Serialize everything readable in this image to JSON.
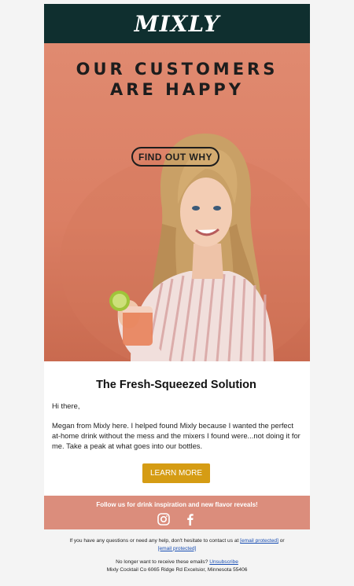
{
  "header": {
    "brand": "MIXLY"
  },
  "hero": {
    "headline_line1": "OUR CUSTOMERS",
    "headline_line2": "ARE HAPPY",
    "cta_label": "FIND OUT WHY"
  },
  "content": {
    "title": "The Fresh-Squeezed Solution",
    "greeting": "Hi there,",
    "body": "Megan from Mixly here. I helped found Mixly because I wanted the perfect at-home drink without the mess and the mixers I found were...not doing it for me. Take a peak at what goes into our bottles.",
    "button_label": "LEARN MORE"
  },
  "social": {
    "text": "Follow us for drink inspiration and new flavor reveals!",
    "icons": [
      "instagram-icon",
      "facebook-icon"
    ]
  },
  "footer": {
    "help_text": "If you have any questions or need any help, don't hesitate to contact us at",
    "email1": "[email protected]",
    "or_text": "or",
    "email2": "[email protected]",
    "unsub_text": "No longer want to receive these emails?",
    "unsub_link": "Unsubscribe",
    "address": "Mixly Cocktail Co 6065 Ridge Rd Excelsior, Minnesota 55406"
  },
  "colors": {
    "header_bg": "#0f2f2f",
    "hero_bg": "#e08a70",
    "button": "#d59c14",
    "social_bg": "#db8d7c"
  }
}
